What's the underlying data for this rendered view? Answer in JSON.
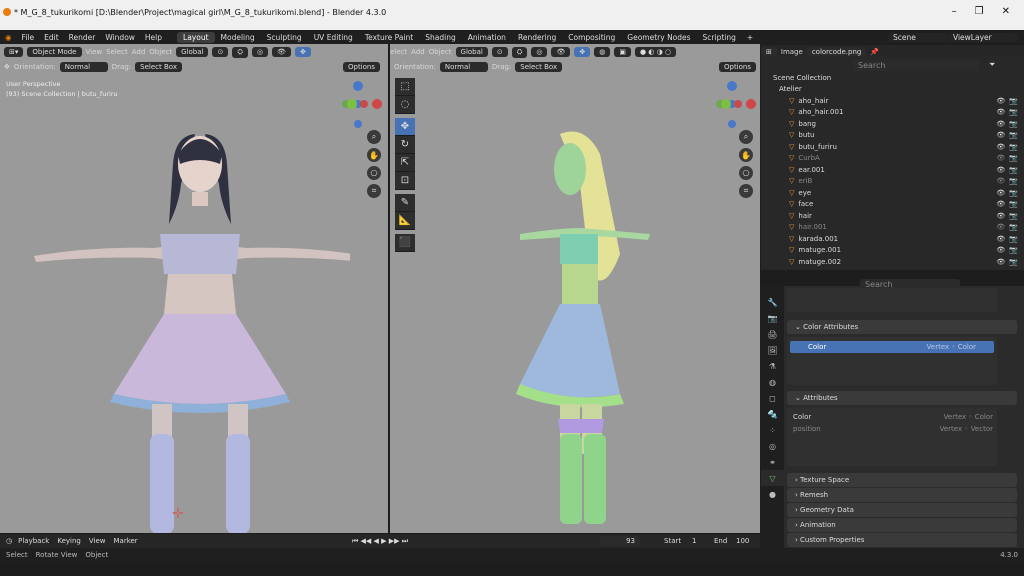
{
  "window": {
    "title": "* M_G_8_tukurikomi [D:\\Blender\\Project\\magical girl\\M_G_8_tukurikomi.blend] - Blender 4.3.0",
    "min": "–",
    "max": "❐",
    "close": "✕"
  },
  "menu": {
    "items": [
      "File",
      "Edit",
      "Render",
      "Window",
      "Help"
    ],
    "tabs": [
      "Layout",
      "Modeling",
      "Sculpting",
      "UV Editing",
      "Texture Paint",
      "Shading",
      "Animation",
      "Rendering",
      "Compositing",
      "Geometry Nodes",
      "Scripting"
    ],
    "add_tab": "+",
    "scene": "Scene",
    "viewlayer": "ViewLayer"
  },
  "left_vp": {
    "mode": "Object Mode",
    "view": "View",
    "select": "Select",
    "add": "Add",
    "object": "Object",
    "transform": "Global",
    "orientation_label": "Orientation:",
    "orientation": "Normal",
    "drag_label": "Drag:",
    "drag": "Select Box",
    "options": "Options",
    "overlay1": "User Perspective",
    "overlay2": "(93) Scene Collection | butu_furiru"
  },
  "right_vp": {
    "select": "elect",
    "add": "Add",
    "object": "Object",
    "transform": "Global",
    "orientation_label": "Orientation:",
    "orientation": "Normal",
    "drag_label": "Drag:",
    "drag": "Select Box",
    "options": "Options"
  },
  "image_header": {
    "image": "Image",
    "file": "colorcode.png"
  },
  "outliner": {
    "search_placeholder": "Search",
    "root": "Scene Collection",
    "collection": "Atelier",
    "rows": [
      {
        "name": "aho_hair",
        "dim": false
      },
      {
        "name": "aho_hair.001",
        "dim": false
      },
      {
        "name": "bang",
        "dim": false
      },
      {
        "name": "butu",
        "dim": false
      },
      {
        "name": "butu_furiru",
        "dim": false
      },
      {
        "name": "CurbA",
        "dim": true
      },
      {
        "name": "ear.001",
        "dim": false
      },
      {
        "name": "eriB",
        "dim": true
      },
      {
        "name": "eye",
        "dim": false
      },
      {
        "name": "face",
        "dim": false
      },
      {
        "name": "hair",
        "dim": false
      },
      {
        "name": "hair.001",
        "dim": true
      },
      {
        "name": "karada.001",
        "dim": false
      },
      {
        "name": "matuge.001",
        "dim": false
      },
      {
        "name": "matuge.002",
        "dim": false
      }
    ]
  },
  "properties": {
    "search_placeholder": "Search",
    "color_attributes": "Color Attributes",
    "ca_item": "Color",
    "ca_item_type": "Vertex ◦ Color",
    "attributes": "Attributes",
    "attr_rows": [
      {
        "name": "Color",
        "type": "Vertex ◦ Color"
      },
      {
        "name": "position",
        "type": "Vertex ◦ Vector"
      }
    ],
    "collapsed": [
      "Texture Space",
      "Remesh",
      "Geometry Data",
      "Animation",
      "Custom Properties"
    ]
  },
  "timeline": {
    "playback": "Playback",
    "keying": "Keying",
    "view": "View",
    "marker": "Marker",
    "frame": "93",
    "start_label": "Start",
    "start": "1",
    "end_label": "End",
    "end": "100"
  },
  "status": {
    "select": "Select",
    "rotate": "Rotate View",
    "object": "Object",
    "version": "4.3.0"
  },
  "colors": {
    "accent": "#4772b3",
    "vp_bg": "#9a9a9a",
    "mesh_green": "#7bc47b"
  }
}
